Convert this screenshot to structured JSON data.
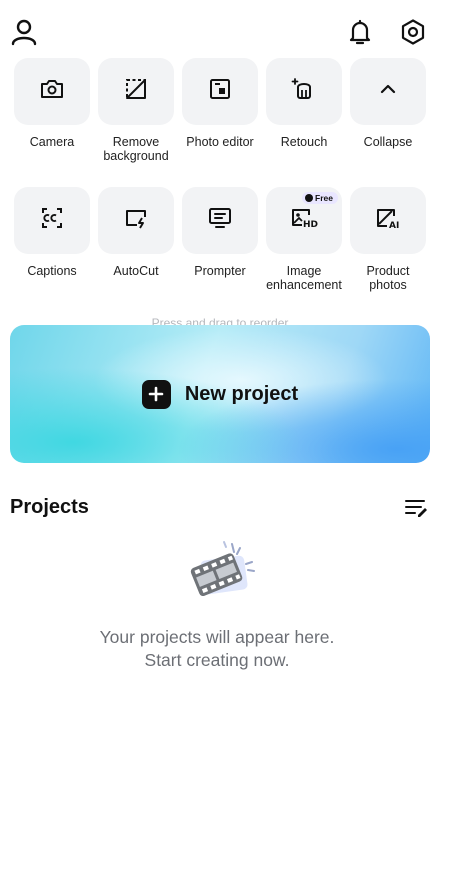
{
  "header": {
    "profile_icon": "person-icon",
    "notification_icon": "bell-icon",
    "settings_icon": "hexagon-gear-icon"
  },
  "tools": {
    "row1": [
      {
        "label": "Camera",
        "icon": "camera-icon"
      },
      {
        "label": "Remove background",
        "icon": "remove-background-icon"
      },
      {
        "label": "Photo editor",
        "icon": "photo-editor-icon"
      },
      {
        "label": "Retouch",
        "icon": "retouch-icon"
      },
      {
        "label": "Collapse",
        "icon": "chevron-up-icon"
      }
    ],
    "row2": [
      {
        "label": "Captions",
        "icon": "captions-icon"
      },
      {
        "label": "AutoCut",
        "icon": "autocut-icon"
      },
      {
        "label": "Prompter",
        "icon": "prompter-icon"
      },
      {
        "label": "Image enhancement",
        "icon": "image-hd-icon",
        "badge": "Free"
      },
      {
        "label": "Product photos",
        "icon": "product-ai-icon"
      }
    ],
    "hint": "Press and drag to reorder"
  },
  "new_project": {
    "label": "New project",
    "icon": "plus-icon"
  },
  "projects": {
    "title": "Projects",
    "sort_icon": "sort-edit-icon",
    "empty_line1": "Your projects will appear here.",
    "empty_line2": "Start creating now."
  },
  "colors": {
    "tile_bg": "#f2f3f5",
    "text_dark": "#111111",
    "muted": "#6c6f75",
    "badge_bg": "#e9e6ff"
  }
}
